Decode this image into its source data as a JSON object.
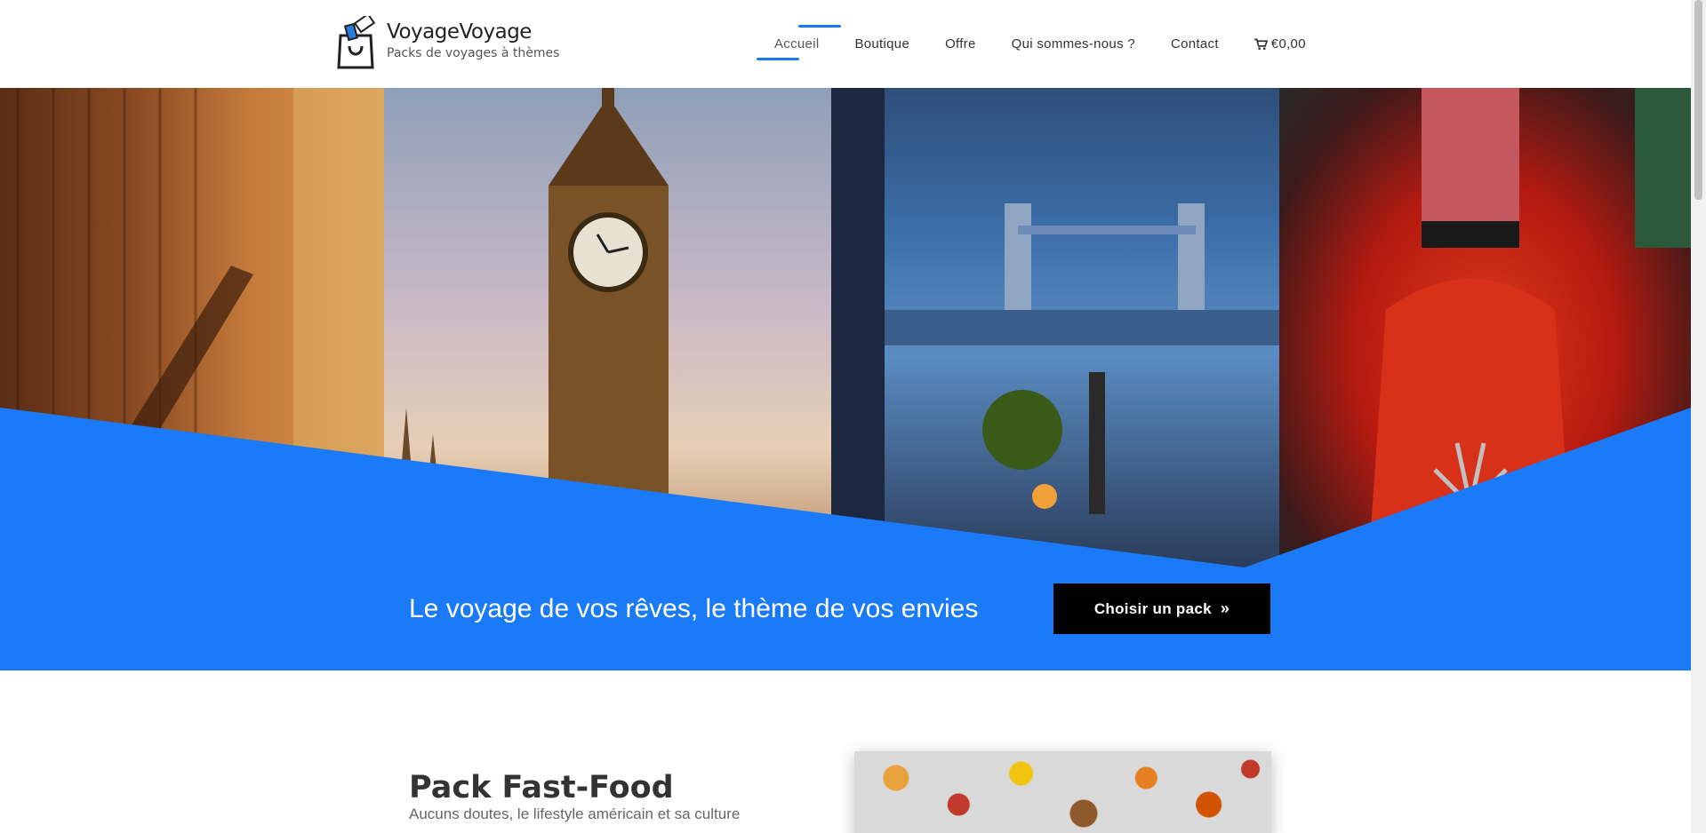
{
  "brand": {
    "name": "VoyageVoyage",
    "tagline": "Packs de voyages à thèmes"
  },
  "nav": {
    "items": [
      {
        "label": "Accueil",
        "active": true
      },
      {
        "label": "Boutique"
      },
      {
        "label": "Offre"
      },
      {
        "label": "Qui sommes-nous ?"
      },
      {
        "label": "Contact"
      }
    ],
    "cart_total": "€0,00",
    "cart_icon": "shopping-cart-icon"
  },
  "hero": {
    "headline": "Le voyage de vos rêves, le thème de vos envies",
    "cta_label": "Choisir un pack",
    "cta_icon": "double-chevron-right-icon",
    "accent_color": "#1a7af8",
    "panels": [
      "hotel-interior",
      "big-ben",
      "tower-bridge-dining",
      "whisky-bottles"
    ]
  },
  "section": {
    "title": "Pack Fast-Food",
    "text": "Aucuns doutes, le lifestyle américain et sa culture"
  },
  "colors": {
    "primary": "#1a7af8",
    "button_bg": "#000000",
    "text_dark": "#333333"
  }
}
